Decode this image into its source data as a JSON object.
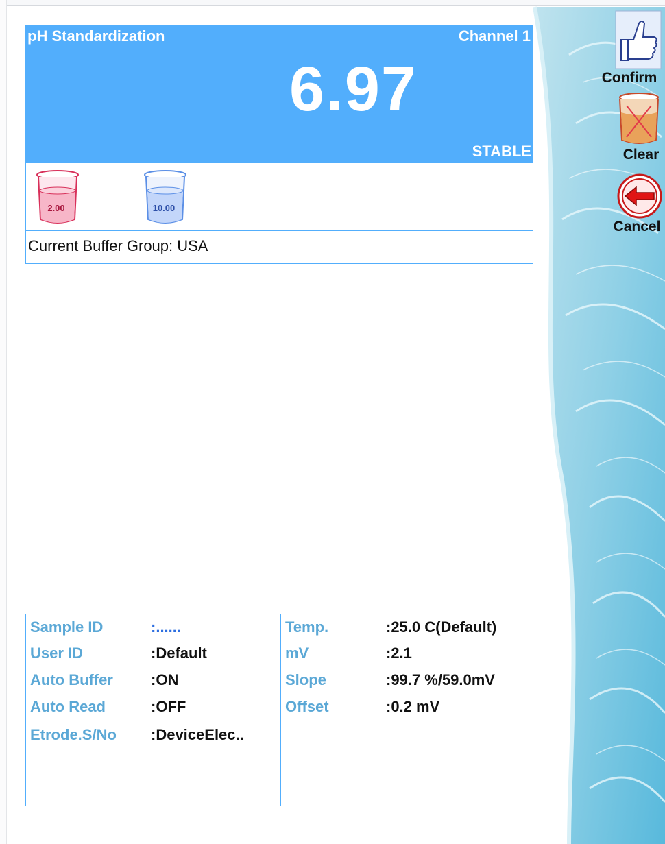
{
  "header": {
    "title": "pH Standardization",
    "channel": "Channel 1",
    "reading": "6.97",
    "status": "STABLE"
  },
  "buffers": [
    {
      "value": "2.00",
      "color": "#d8305a"
    },
    {
      "value": "10.00",
      "color": "#5b8fe6"
    }
  ],
  "buffer_group": "Current Buffer Group: USA",
  "info_left": [
    {
      "label": "Sample ID",
      "value": ":......"
    },
    {
      "label": "User ID",
      "value": ":Default"
    },
    {
      "label": "Auto Buffer",
      "value": ":ON"
    },
    {
      "label": "Auto Read",
      "value": ":OFF"
    },
    {
      "label": "Etrode.S/No",
      "value": ":DeviceElec.."
    }
  ],
  "info_right": [
    {
      "label": "Temp.",
      "value": ":25.0 C(Default)"
    },
    {
      "label": "mV",
      "value": ":2.1"
    },
    {
      "label": "Slope",
      "value": ":99.7 %/59.0mV"
    },
    {
      "label": "Offset",
      "value": ":0.2 mV"
    }
  ],
  "actions": {
    "confirm": "Confirm",
    "clear": "Clear",
    "cancel": "Cancel"
  },
  "colors": {
    "accent": "#52aefc",
    "label": "#5ba8d6",
    "sample_id_value": "#2d6ee0"
  }
}
